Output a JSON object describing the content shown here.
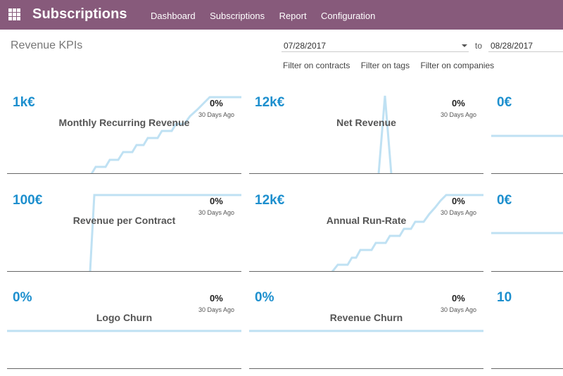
{
  "app": {
    "title": "Subscriptions"
  },
  "menu": [
    "Dashboard",
    "Subscriptions",
    "Report",
    "Configuration"
  ],
  "page": {
    "title": "Revenue KPIs"
  },
  "date_range": {
    "from": "07/28/2017",
    "to_label": "to",
    "to": "08/28/2017"
  },
  "filters": [
    "Filter on contracts",
    "Filter on tags",
    "Filter on companies"
  ],
  "colors": {
    "brand": "#875a7b",
    "kpi_value": "#1d8fce",
    "sparkline": "#bfe1f3"
  },
  "kpis": [
    {
      "value": "1k€",
      "title": "Monthly Recurring Revenue",
      "pct": "0%",
      "ago": "30 Days Ago"
    },
    {
      "value": "12k€",
      "title": "Net Revenue",
      "pct": "0%",
      "ago": "30 Days Ago"
    },
    {
      "value": "0€",
      "title": "",
      "pct": "",
      "ago": ""
    },
    {
      "value": "100€",
      "title": "Revenue per Contract",
      "pct": "0%",
      "ago": "30 Days Ago"
    },
    {
      "value": "12k€",
      "title": "Annual Run-Rate",
      "pct": "0%",
      "ago": "30 Days Ago"
    },
    {
      "value": "0€",
      "title": "",
      "pct": "",
      "ago": ""
    },
    {
      "value": "0%",
      "title": "Logo Churn",
      "pct": "0%",
      "ago": "30 Days Ago"
    },
    {
      "value": "0%",
      "title": "Revenue Churn",
      "pct": "0%",
      "ago": "30 Days Ago"
    },
    {
      "value": "10",
      "title": "",
      "pct": "",
      "ago": ""
    }
  ]
}
